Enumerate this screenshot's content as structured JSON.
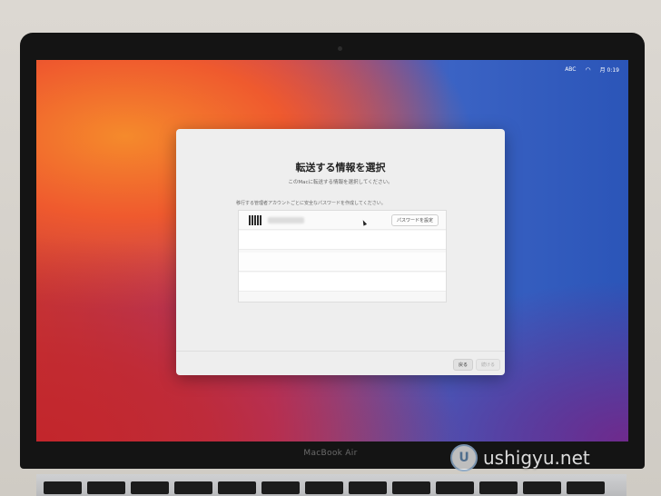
{
  "menubar": {
    "input_source": "ABC",
    "clock": "月 0:19",
    "icons": [
      "input-source-icon",
      "wifi-icon"
    ]
  },
  "dialog": {
    "title": "転送する情報を選択",
    "subtitle": "このMacに転送する情報を選択してください。",
    "instruction": "移行する管理者アカウントごとに安全なパスワードを作成してください。",
    "account_row": {
      "set_password_label": "パスワードを設定"
    },
    "buttons": {
      "back": "戻る",
      "continue": "続ける"
    }
  },
  "laptop": {
    "model": "MacBook Air"
  },
  "watermark": {
    "text": "ushigyu.net",
    "logo_letter": "U"
  }
}
